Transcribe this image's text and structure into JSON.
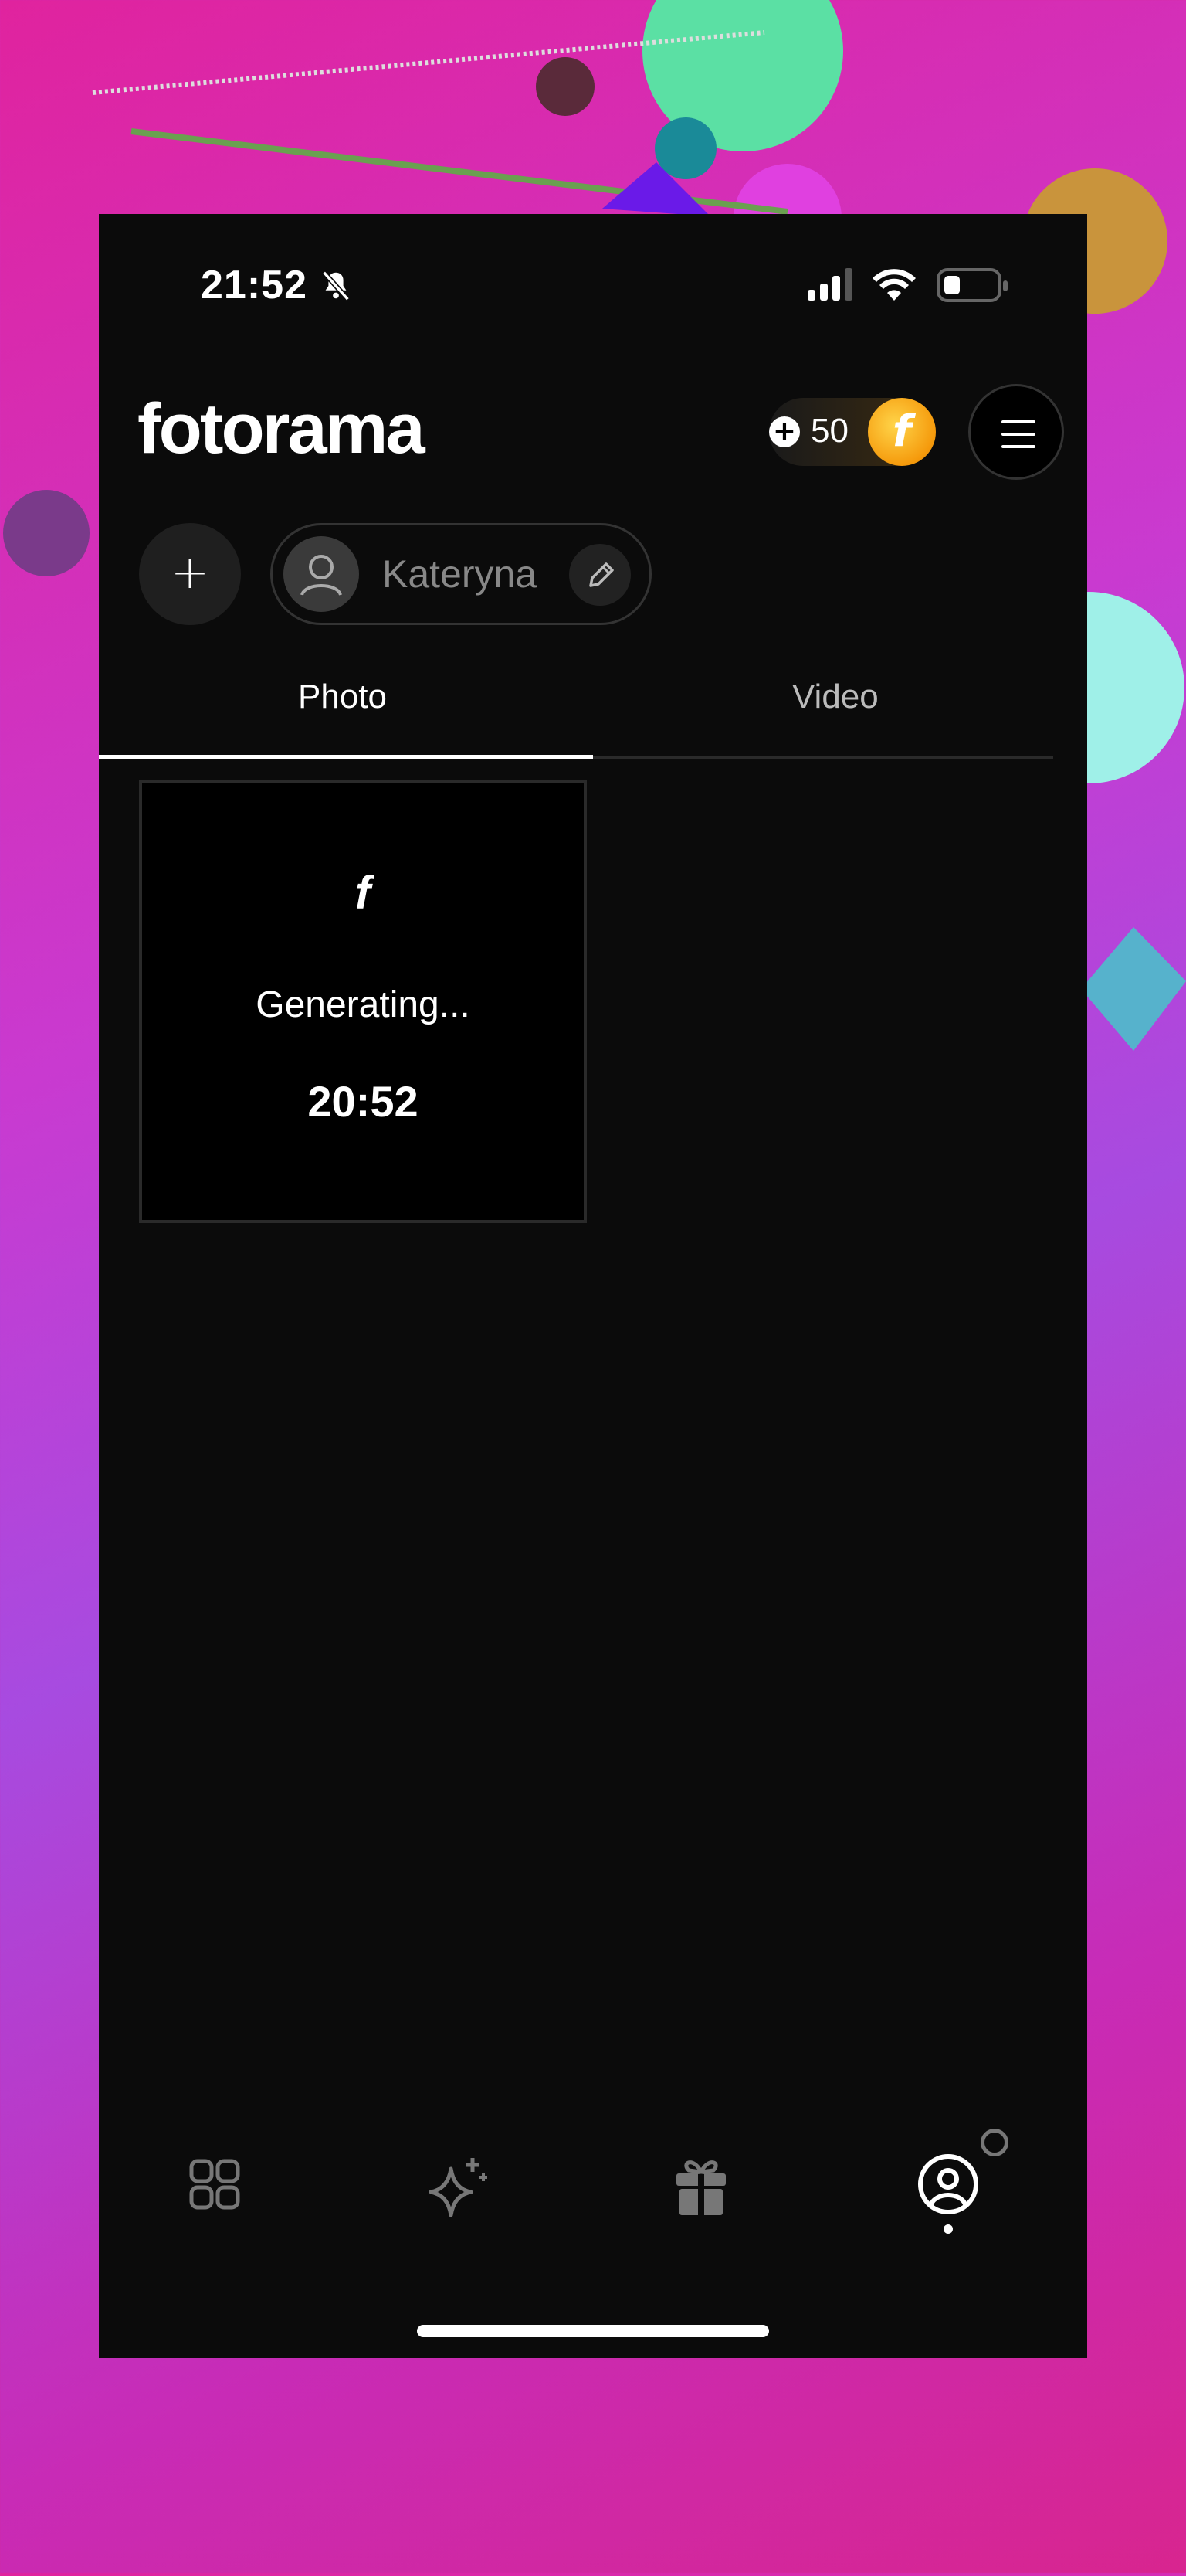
{
  "colors": {
    "background_gradient_start": "#e0239e",
    "background_gradient_end": "#c82bb6",
    "phone_background": "#0b0b0b",
    "coin_gold": "#f5a30c",
    "text_primary": "#ffffff",
    "text_muted": "#888888"
  },
  "status_bar": {
    "time": "21:52",
    "icons": [
      "bell-slash-icon",
      "cellular-signal-icon",
      "wifi-icon",
      "battery-low-icon"
    ]
  },
  "header": {
    "logo_text": "fotorama",
    "coins": {
      "count": "50",
      "add_icon": "plus-circle-icon",
      "coin_icon": "coin-icon"
    },
    "menu_icon": "hamburger-menu-icon"
  },
  "profile_bar": {
    "add_icon": "plus-icon",
    "profile_name": "Kateryna",
    "avatar_icon": "user-avatar-icon",
    "edit_icon": "pencil-icon"
  },
  "tabs": [
    {
      "label": "Photo",
      "active": true
    },
    {
      "label": "Video",
      "active": false
    }
  ],
  "gallery": [
    {
      "logo_glyph": "f",
      "status": "Generating...",
      "time": "20:52"
    }
  ],
  "bottom_nav": [
    {
      "name": "apps-grid-icon",
      "active": false
    },
    {
      "name": "sparkle-icon",
      "active": false
    },
    {
      "name": "gift-icon",
      "active": false
    },
    {
      "name": "profile-icon",
      "active": true
    }
  ]
}
